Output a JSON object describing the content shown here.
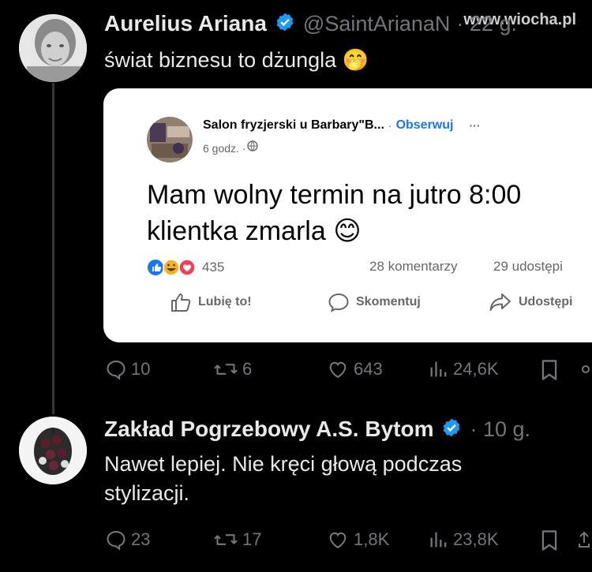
{
  "watermark": "www.wiocha.pl",
  "tweet1": {
    "author_name": "Aurelius Ariana",
    "handle": "@SaintArianaN",
    "time": "· 22 g.",
    "text": "świat biznesu to dżungla 🤭",
    "actions": {
      "replies": "10",
      "reposts": "6",
      "likes": "643",
      "views": "24,6K"
    }
  },
  "quoted_post": {
    "page_name": "Salon fryzjerski u Barbary\"B...",
    "separator": "·",
    "follow_label": "Obserwuj",
    "more": "···",
    "time": "6 godz. · ",
    "text": "Mam wolny termin na jutro 8:00 klientka zmarla 😊",
    "reactions_count": "435",
    "comments": "28 komentarzy",
    "shares": "29 udostępi",
    "buttons": {
      "like": "Lubię to!",
      "comment": "Skomentuj",
      "share": "Udostępi"
    }
  },
  "tweet2": {
    "author_name": "Zakład Pogrzebowy A.S. Bytom",
    "time": "· 10 g.",
    "text": "Nawet lepiej. Nie kręci głową podczas stylizacji.",
    "actions": {
      "replies": "23",
      "reposts": "17",
      "likes": "1,8K",
      "views": "23,8K"
    }
  },
  "colors": {
    "background": "#000000",
    "verified": "#1d9bf0",
    "facebook_blue": "#1877f2",
    "muted": "#71767b"
  }
}
